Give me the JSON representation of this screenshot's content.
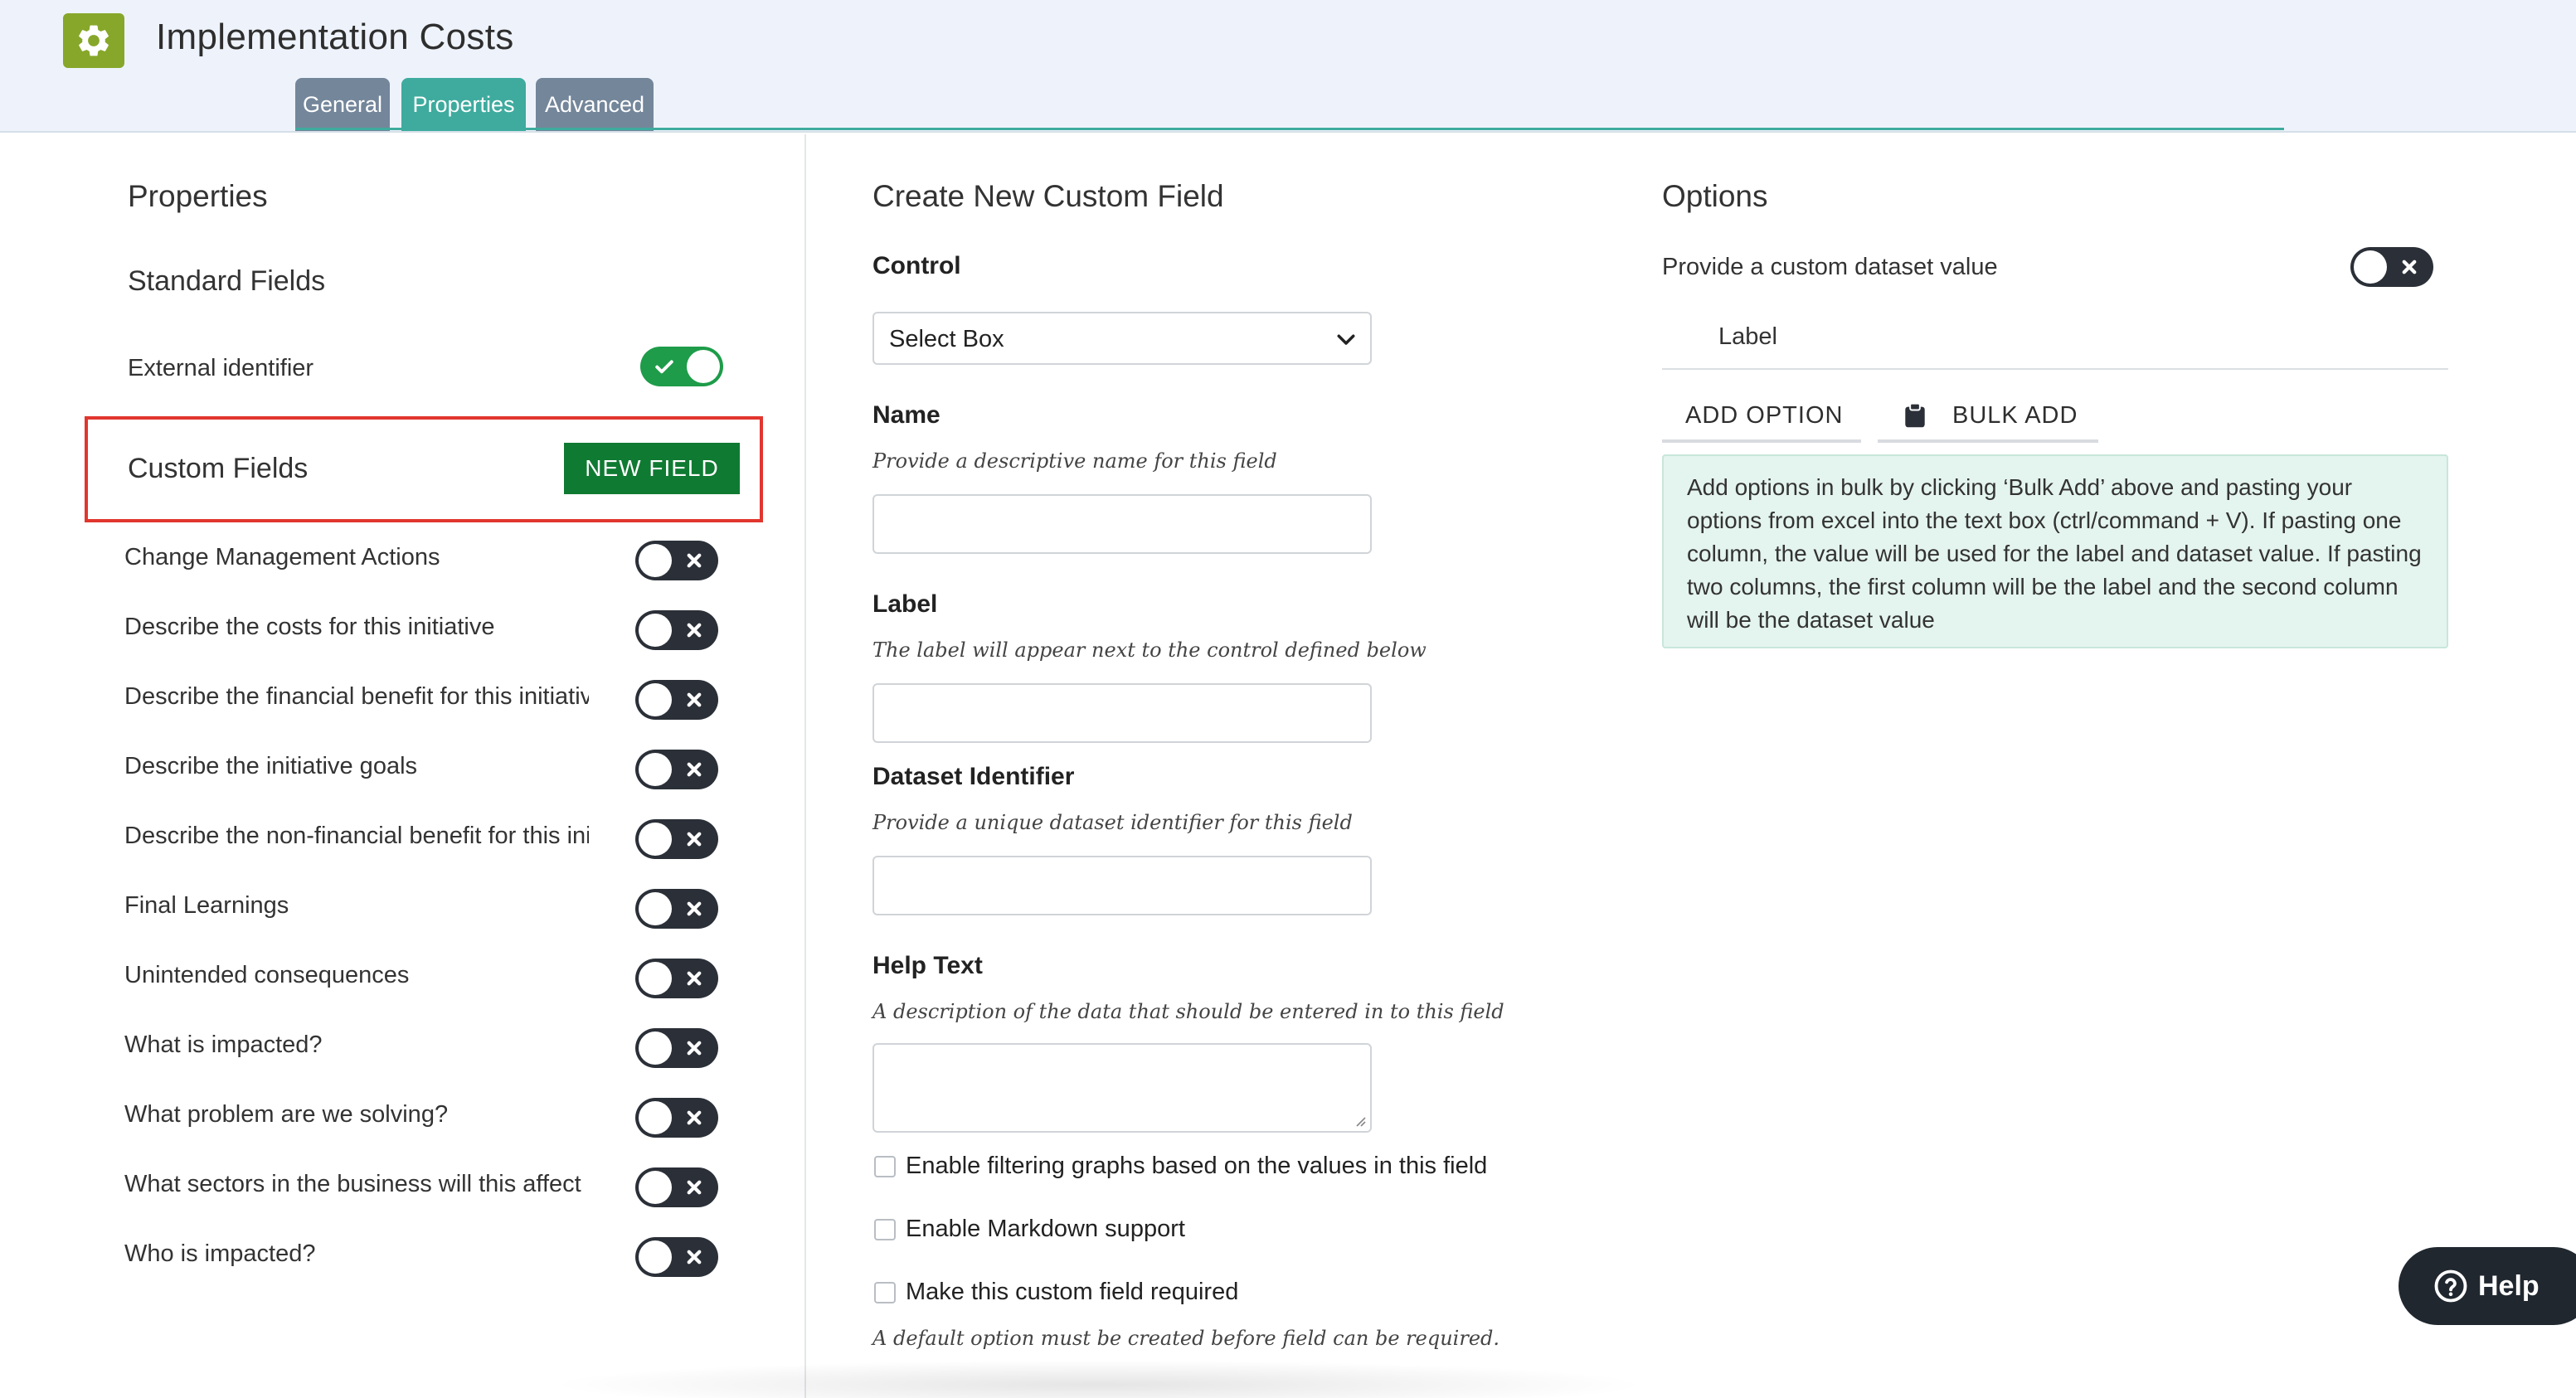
{
  "header": {
    "title": "Implementation Costs",
    "icon": "gear-icon",
    "tabs": [
      {
        "label": "General"
      },
      {
        "label": "Properties"
      },
      {
        "label": "Advanced"
      }
    ]
  },
  "properties": {
    "heading": "Properties",
    "standard_heading": "Standard Fields",
    "external_identifier_label": "External identifier",
    "external_identifier_on": true,
    "custom_heading": "Custom Fields",
    "new_field_label": "NEW FIELD",
    "custom_fields": [
      {
        "label": "Change Management Actions",
        "enabled": false
      },
      {
        "label": "Describe the costs for this initiative",
        "enabled": false
      },
      {
        "label": "Describe the financial benefit for this initiative",
        "enabled": false
      },
      {
        "label": "Describe the initiative goals",
        "enabled": false
      },
      {
        "label": "Describe the non-financial benefit for this initiative",
        "enabled": false
      },
      {
        "label": "Final Learnings",
        "enabled": false
      },
      {
        "label": "Unintended consequences",
        "enabled": false
      },
      {
        "label": "What is impacted?",
        "enabled": false
      },
      {
        "label": "What problem are we solving?",
        "enabled": false
      },
      {
        "label": "What sectors in the business will this affect",
        "enabled": false
      },
      {
        "label": "Who is impacted?",
        "enabled": false
      }
    ]
  },
  "create_field": {
    "heading": "Create New Custom Field",
    "control_label": "Control",
    "control_value": "Select Box",
    "name_label": "Name",
    "name_help": "Provide a descriptive name for this field",
    "name_value": "",
    "label_label": "Label",
    "label_help": "The label will appear next to the control defined below",
    "label_value": "",
    "dataset_label": "Dataset Identifier",
    "dataset_help": "Provide a unique dataset identifier for this field",
    "dataset_value": "",
    "helptext_label": "Help Text",
    "helptext_help": "A description of the data that should be entered in to this field",
    "helptext_value": "",
    "checkboxes": [
      {
        "label": "Enable filtering graphs based on the values in this field",
        "checked": false
      },
      {
        "label": "Enable Markdown support",
        "checked": false
      },
      {
        "label": "Make this custom field required",
        "checked": false
      }
    ],
    "required_note": "A default option must be created before field can be required."
  },
  "options": {
    "heading": "Options",
    "custom_dataset_label": "Provide a custom dataset value",
    "custom_dataset_on": false,
    "label_column": "Label",
    "add_option_label": "ADD OPTION",
    "bulk_add_label": "BULK ADD",
    "info_text": "Add options in bulk by clicking ‘Bulk Add’ above and pasting your options from excel into the text box (ctrl/command + V). If pasting one column, the value will be used for the label and dataset value. If pasting two columns, the first column will be the label and the second column will be the dataset value"
  },
  "help_widget": {
    "label": "Help",
    "icon": "question-circle-icon"
  },
  "colors": {
    "accent": "#3eab9e",
    "tab_inactive": "#74869a",
    "new_field_button": "#0f7a32",
    "toggle_on": "#1e9c49",
    "toggle_off": "#2b3038",
    "highlight_border": "#e1362e",
    "info_background": "#e4f4ef"
  }
}
